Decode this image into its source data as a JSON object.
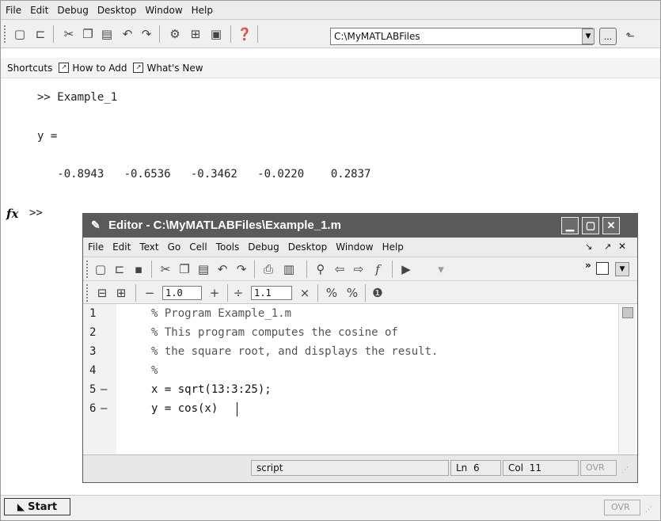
{
  "main_window": {
    "menu": [
      "File",
      "Edit",
      "Debug",
      "Desktop",
      "Window",
      "Help"
    ],
    "current_directory": "C:\\MyMATLABFiles",
    "browse_label": "...",
    "shortcuts": {
      "label": "Shortcuts",
      "items": [
        "How to Add",
        "What's New"
      ]
    },
    "start_label": "Start",
    "ovr_label": "OVR"
  },
  "command_window": {
    "lines": [
      ">> Example_1",
      "y =",
      "   -0.8943   -0.6536   -0.3462   -0.0220    0.2837",
      ">>"
    ],
    "fx_label": "fx"
  },
  "editor": {
    "title": "Editor - C:\\MyMATLABFiles\\Example_1.m",
    "menu": [
      "File",
      "Edit",
      "Text",
      "Go",
      "Cell",
      "Tools",
      "Debug",
      "Desktop",
      "Window",
      "Help"
    ],
    "cell_field_1": "1.0",
    "cell_field_2": "1.1",
    "code_lines": [
      {
        "num": "1",
        "mark": "",
        "text": "% Program Example_1.m",
        "comment": true
      },
      {
        "num": "2",
        "mark": "",
        "text": "% This program computes the cosine of",
        "comment": true
      },
      {
        "num": "3",
        "mark": "",
        "text": "% the square root, and displays the result.",
        "comment": true
      },
      {
        "num": "4",
        "mark": "",
        "text": "%",
        "comment": true
      },
      {
        "num": "5",
        "mark": "–",
        "text": "x = sqrt(13:3:25);",
        "comment": false
      },
      {
        "num": "6",
        "mark": "–",
        "text": "y = cos(x)",
        "comment": false
      }
    ],
    "status": {
      "file_type": "script",
      "line_label": "Ln",
      "line": "6",
      "col_label": "Col",
      "col": "11",
      "ovr": "OVR"
    }
  }
}
